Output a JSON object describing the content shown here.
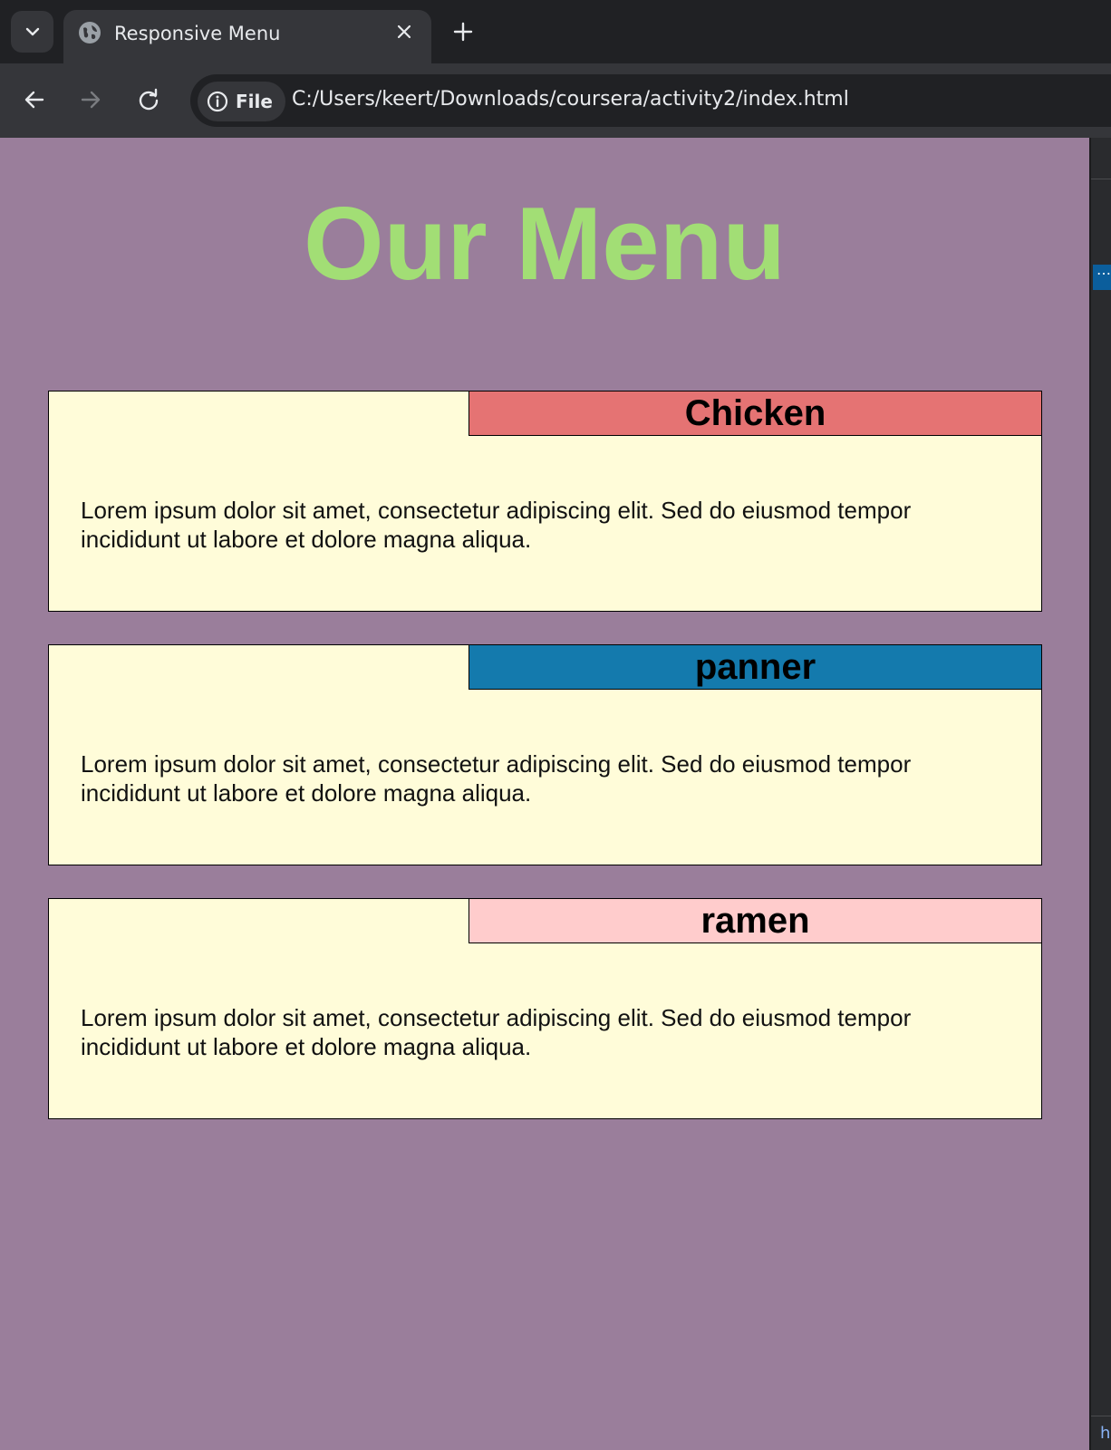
{
  "browser": {
    "tab_title": "Responsive Menu",
    "chip_label": "File",
    "url": "C:/Users/keert/Downloads/coursera/activity2/index.html"
  },
  "page": {
    "heading": "Our Menu",
    "heading_color": "#a2de75",
    "background_color": "#9a7e9b",
    "card_background": "#fffcd9",
    "items": [
      {
        "title": "Chicken",
        "label_color": "#e57373",
        "text": "Lorem ipsum dolor sit amet, consectetur adipiscing elit. Sed do eiusmod tempor incididunt ut labore et dolore magna aliqua."
      },
      {
        "title": "panner",
        "label_color": "#147aad",
        "text": "Lorem ipsum dolor sit amet, consectetur adipiscing elit. Sed do eiusmod tempor incididunt ut labore et dolore magna aliqua."
      },
      {
        "title": "ramen",
        "label_color": "#ffcccc",
        "text": "Lorem ipsum dolor sit amet, consectetur adipiscing elit. Sed do eiusmod tempor incididunt ut labore et dolore magna aliqua."
      }
    ]
  },
  "devtools": {
    "badge": "⋯",
    "bottom_text": "h"
  }
}
